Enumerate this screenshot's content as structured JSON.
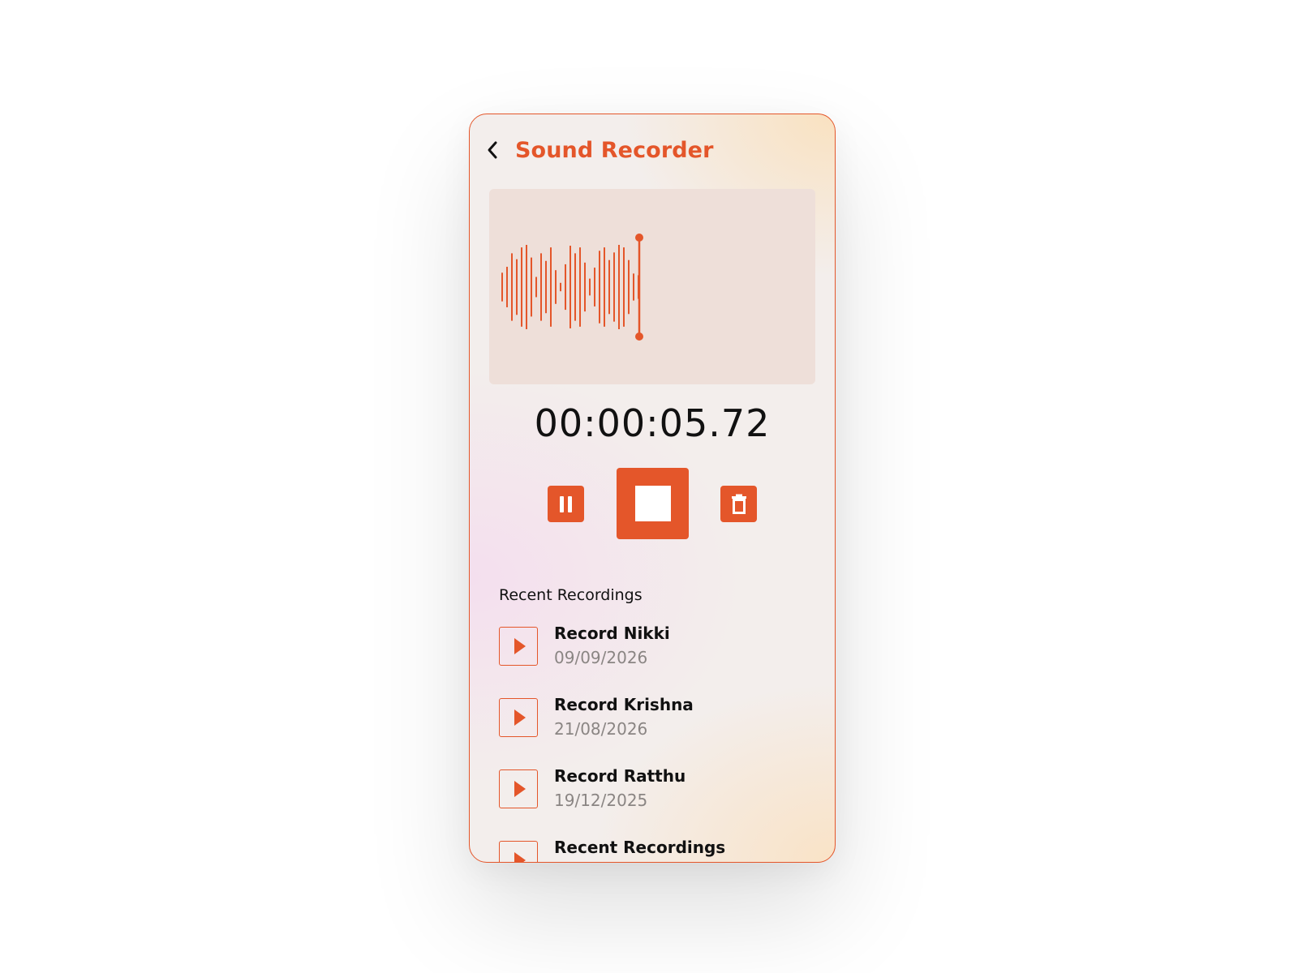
{
  "app": {
    "title": "Sound Recorder",
    "accent_color": "#e4562a",
    "back_icon": "chevron-left-icon"
  },
  "recorder": {
    "timer": "00:00:05.72",
    "waveform_amplitudes": [
      0.34,
      0.48,
      0.8,
      0.66,
      0.94,
      1.0,
      0.7,
      0.24,
      0.8,
      0.62,
      0.94,
      0.4,
      0.1,
      0.54,
      0.98,
      0.8,
      0.94,
      0.58,
      0.2,
      0.46,
      0.86,
      0.94,
      0.64,
      0.82,
      1.0,
      0.94,
      0.64,
      0.32,
      0.28
    ]
  },
  "controls": {
    "pause_icon": "pause-icon",
    "stop_icon": "stop-icon",
    "delete_icon": "trash-icon"
  },
  "recent": {
    "title": "Recent Recordings",
    "items": [
      {
        "name": "Record Nikki",
        "date": "09/09/2026"
      },
      {
        "name": "Record Krishna",
        "date": "21/08/2026"
      },
      {
        "name": "Record Ratthu",
        "date": "19/12/2025"
      },
      {
        "name": "Recent Recordings",
        "date": ""
      }
    ]
  }
}
